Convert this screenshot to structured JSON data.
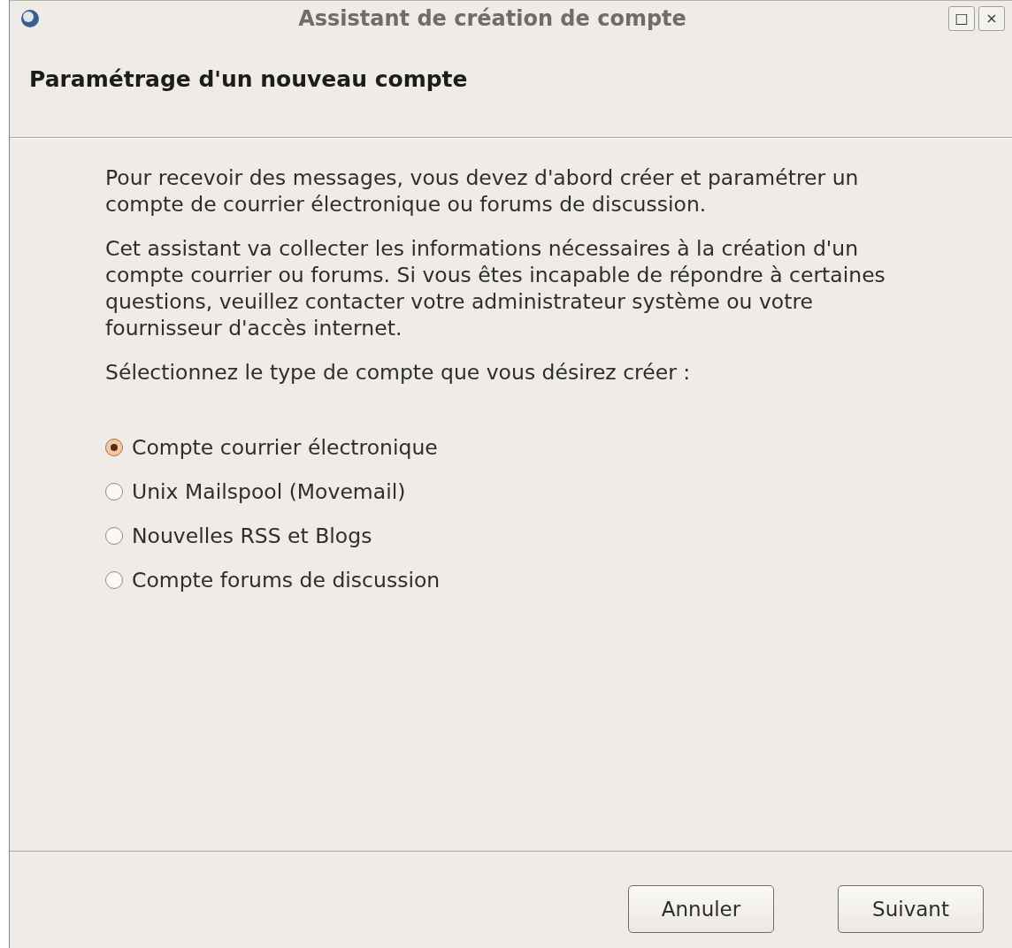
{
  "window": {
    "title": "Assistant de création de compte",
    "controls": [
      {
        "label": "□"
      },
      {
        "label": "×"
      }
    ]
  },
  "header": {
    "title": "Paramétrage d'un nouveau compte"
  },
  "paragraphs": [
    "Pour recevoir des messages, vous devez d'abord créer et paramétrer un compte de courrier électronique ou forums de discussion.",
    "Cet assistant va collecter les informations nécessaires à la création d'un compte courrier ou forums. Si vous êtes incapable de répondre à certaines questions, veuillez contacter votre administrateur système ou votre fournisseur d'accès internet.",
    "Sélectionnez le type de compte que vous désirez créer :"
  ],
  "account_types": [
    {
      "label": "Compte courrier électronique",
      "selected": true
    },
    {
      "label": "Unix Mailspool (Movemail)",
      "selected": false
    },
    {
      "label": "Nouvelles RSS et Blogs",
      "selected": false
    },
    {
      "label": "Compte forums de discussion",
      "selected": false
    }
  ],
  "buttons": [
    {
      "label": "Annuler"
    },
    {
      "label": "Suivant"
    }
  ]
}
